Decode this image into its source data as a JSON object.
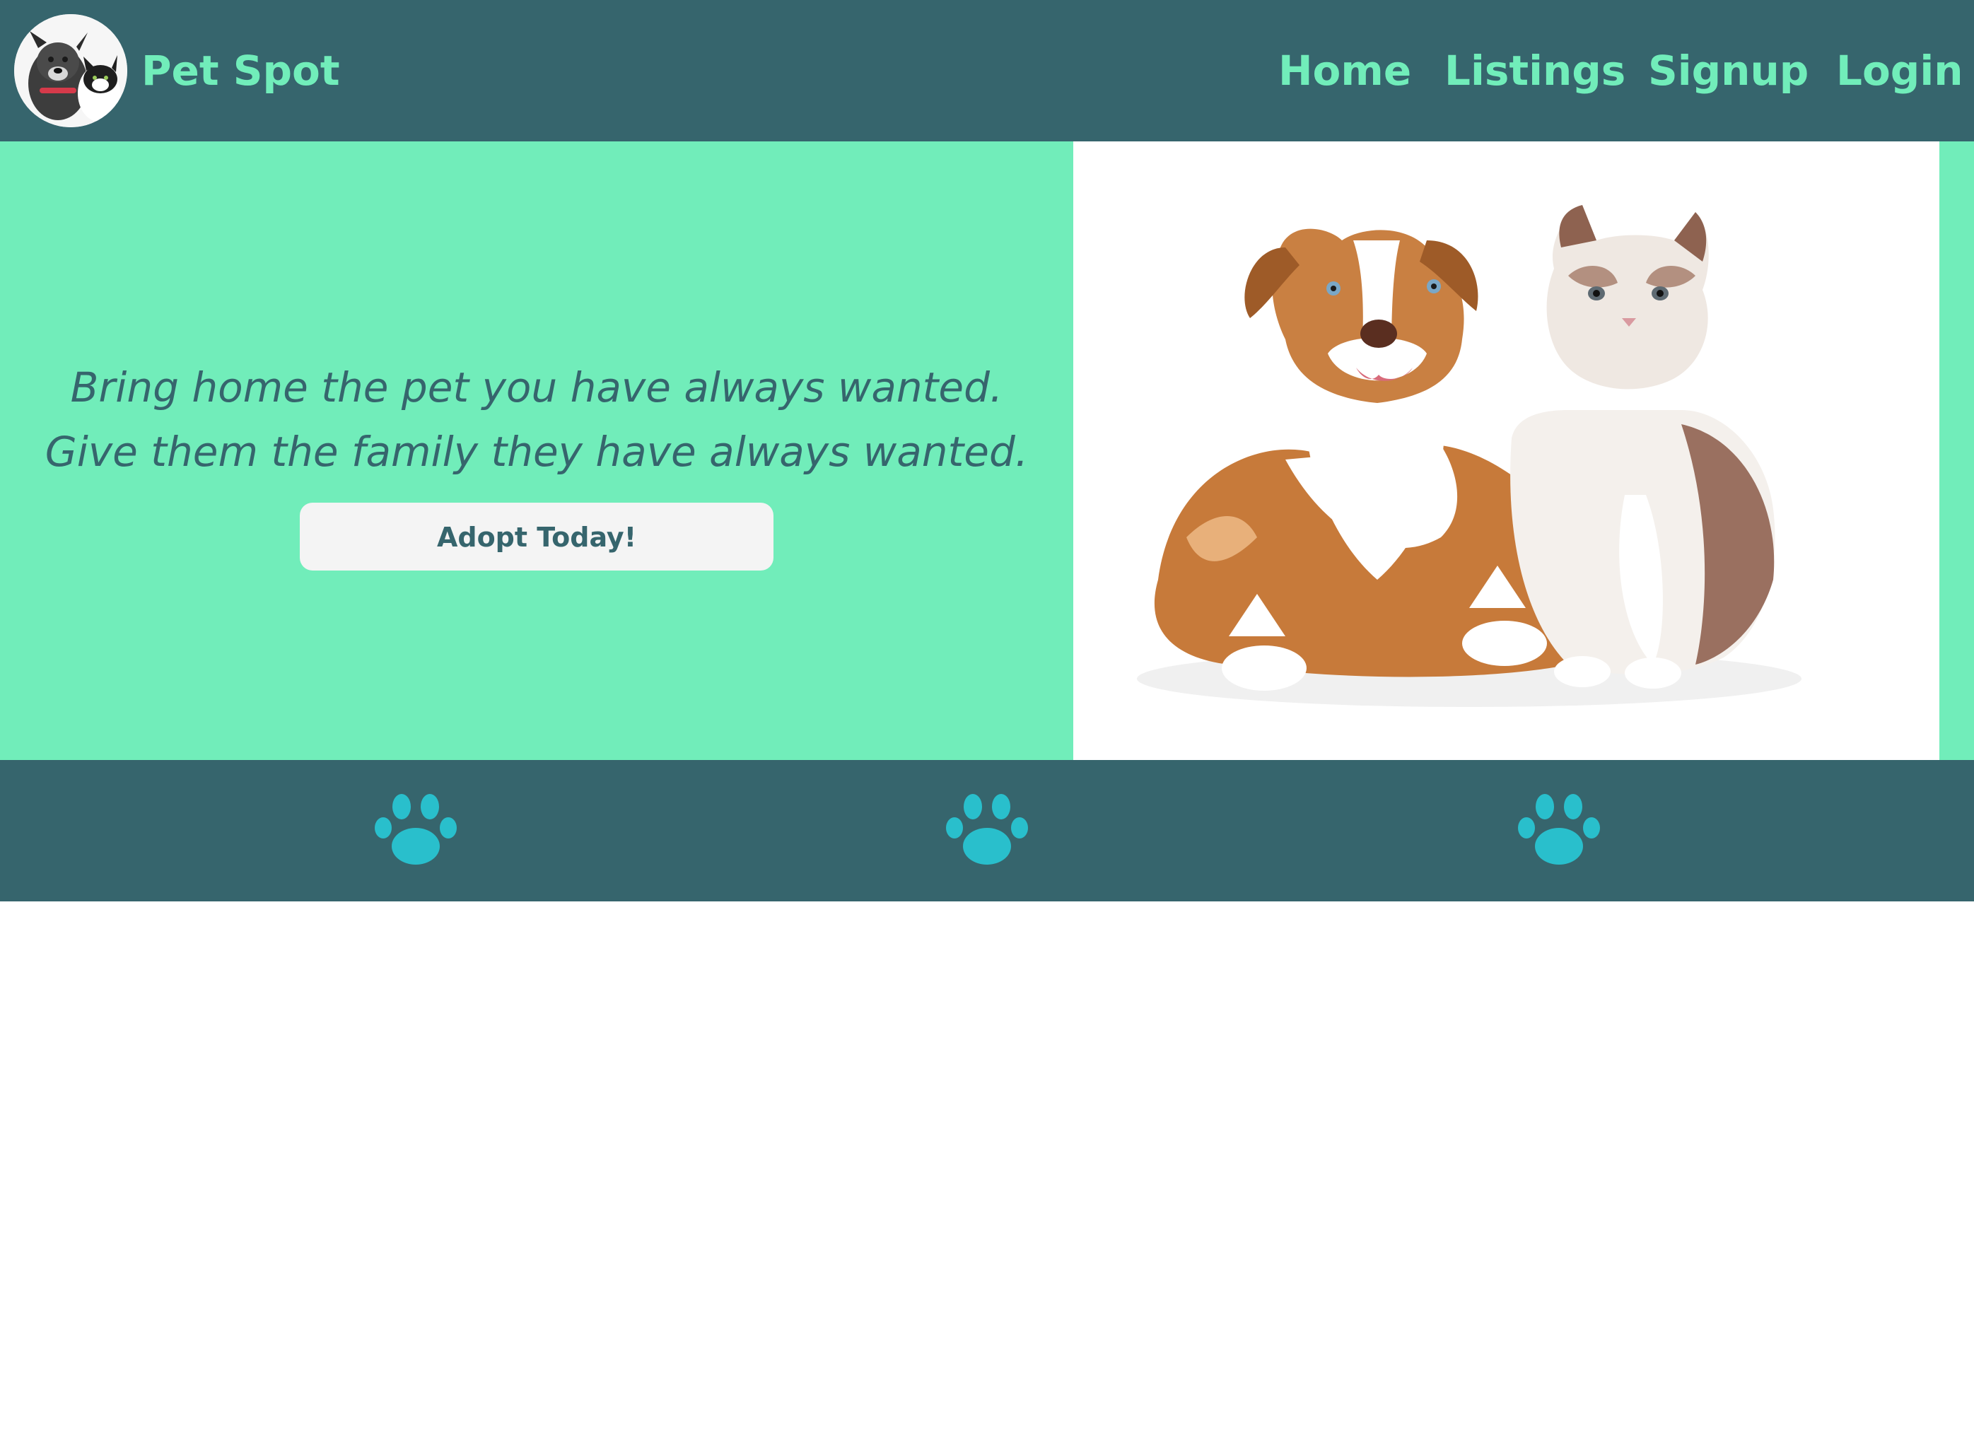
{
  "header": {
    "brand": "Pet Spot",
    "logo_icon": "dog-and-cat-avatar-icon",
    "nav": [
      {
        "label": "Home"
      },
      {
        "label": "Listings"
      },
      {
        "label": "Signup"
      },
      {
        "label": "Login"
      }
    ]
  },
  "hero": {
    "tagline_line1": "Bring home the pet you have always wanted.",
    "tagline_line2": "Give them the family they have always wanted.",
    "cta_label": "Adopt Today!",
    "photo_icon": "dog-and-cat-photo"
  },
  "footer_strip": {
    "icons": [
      "paw-icon",
      "paw-icon",
      "paw-icon"
    ]
  },
  "colors": {
    "navbar": "#36656d",
    "accent": "#71edba",
    "button_bg": "#f4f4f4",
    "paw": "#29bfcc"
  }
}
